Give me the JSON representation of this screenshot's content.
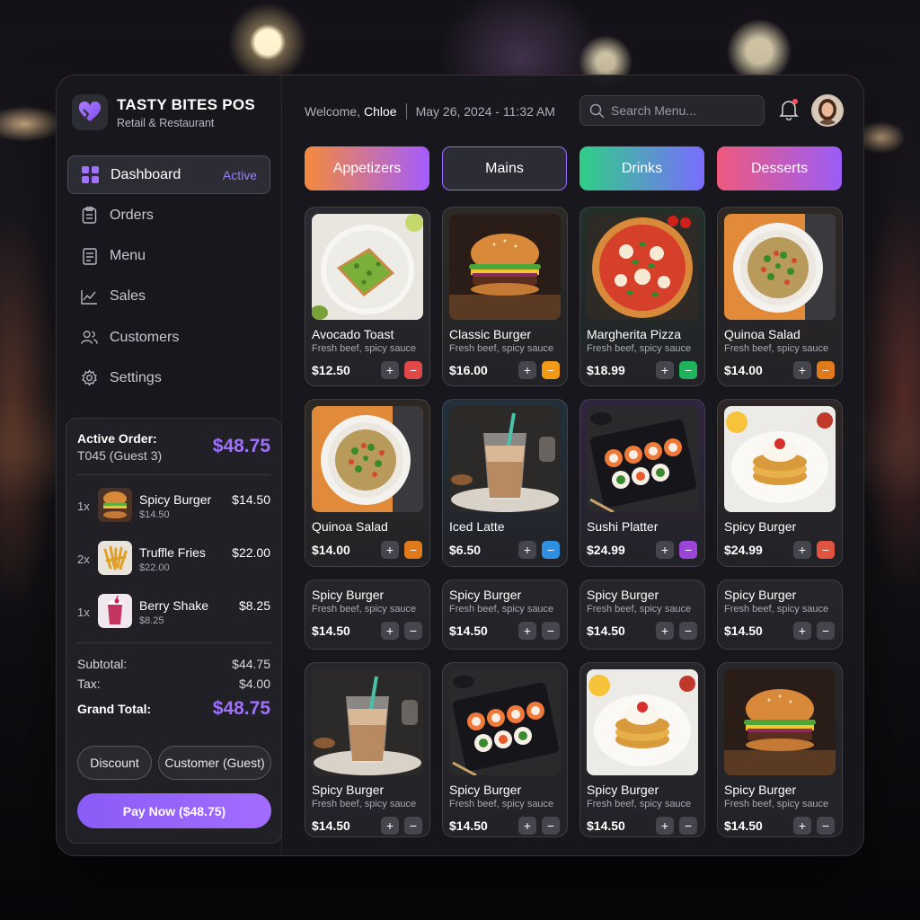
{
  "app": {
    "name": "TASTY BITES POS",
    "subtitle": "Retail & Restaurant",
    "accent": "#9c6bff"
  },
  "nav": {
    "items": [
      {
        "label": "Dashboard",
        "icon": "dashboard-grid-icon",
        "badge": "Active"
      },
      {
        "label": "Orders",
        "icon": "clipboard-icon"
      },
      {
        "label": "Menu",
        "icon": "menu-list-icon"
      },
      {
        "label": "Sales",
        "icon": "chart-line-icon"
      },
      {
        "label": "Customers",
        "icon": "users-icon"
      },
      {
        "label": "Settings",
        "icon": "gear-icon"
      }
    ]
  },
  "header": {
    "welcome_prefix": "Welcome,",
    "user": "Chloe",
    "datetime": "May 26, 2024 - 11:32 AM",
    "search_placeholder": "Search Menu...",
    "has_notification": true
  },
  "categories": [
    {
      "label": "Appetizers",
      "style": "gradient",
      "colors": [
        "#f58a3c",
        "#a35cff"
      ]
    },
    {
      "label": "Mains",
      "style": "selected",
      "colors": [
        "#2c2c34",
        "#9a6bff"
      ]
    },
    {
      "label": "Drinks",
      "style": "gradient",
      "colors": [
        "#2fcf86",
        "#7a6cff"
      ]
    },
    {
      "label": "Desserts",
      "style": "gradient",
      "colors": [
        "#ee5a7e",
        "#9b5cf6"
      ]
    }
  ],
  "menu_items": [
    {
      "name": "Avocado Toast",
      "desc": "Fresh beef, spicy sauce",
      "price": "$12.50",
      "image": "avocado-toast",
      "minus_color": "#e04848",
      "tint": "#2a2a30"
    },
    {
      "name": "Classic Burger",
      "desc": "Fresh beef, spicy sauce",
      "price": "$16.00",
      "image": "burger",
      "minus_color": "#f29a13",
      "tint": "#2c2a26"
    },
    {
      "name": "Margherita Pizza",
      "desc": "Fresh beef, spicy sauce",
      "price": "$18.99",
      "image": "pizza",
      "minus_color": "#1fb35c",
      "tint": "#22302a"
    },
    {
      "name": "Quinoa Salad",
      "desc": "Fresh beef, spicy sauce",
      "price": "$14.00",
      "image": "quinoa-salad",
      "minus_color": "#e07a1a",
      "tint": "#2e2824"
    },
    {
      "name": "Quinoa Salad",
      "desc": "",
      "price": "$14.00",
      "image": "quinoa-salad",
      "minus_color": "#e07a1a",
      "tint": "#2e2824"
    },
    {
      "name": "Iced Latte",
      "desc": "",
      "price": "$6.50",
      "image": "iced-latte",
      "minus_color": "#2f8fe0",
      "tint": "#22303c"
    },
    {
      "name": "Sushi Platter",
      "desc": "",
      "price": "$24.99",
      "image": "sushi",
      "minus_color": "#9a45d8",
      "tint": "#302540"
    },
    {
      "name": "Spicy Burger",
      "desc": "",
      "price": "$24.99",
      "image": "pancake",
      "minus_color": "#e0533f",
      "tint": "#2e2626"
    },
    {
      "name": "Spicy Burger",
      "desc": "Fresh beef, spicy sauce",
      "price": "$14.50",
      "image": "",
      "minus_color": "#45454d",
      "tint": "#26262b"
    },
    {
      "name": "Spicy Burger",
      "desc": "Fresh beef, spicy sauce",
      "price": "$14.50",
      "image": "",
      "minus_color": "#45454d",
      "tint": "#26262b"
    },
    {
      "name": "Spicy Burger",
      "desc": "Fresh beef, spicy sauce",
      "price": "$14.50",
      "image": "",
      "minus_color": "#45454d",
      "tint": "#26262b"
    },
    {
      "name": "Spicy Burger",
      "desc": "Fresh beef, spicy sauce",
      "price": "$14.50",
      "image": "",
      "minus_color": "#45454d",
      "tint": "#26262b"
    },
    {
      "name": "Spicy Burger",
      "desc": "Fresh beef, spicy sauce",
      "price": "$14.50",
      "image": "iced-latte",
      "minus_color": "#45454d",
      "tint": "#26262b"
    },
    {
      "name": "Spicy Burger",
      "desc": "Fresh beef, spicy sauce",
      "price": "$14.50",
      "image": "sushi",
      "minus_color": "#45454d",
      "tint": "#26262b"
    },
    {
      "name": "Spicy Burger",
      "desc": "Fresh beef, spicy sauce",
      "price": "$14.50",
      "image": "pancake",
      "minus_color": "#45454d",
      "tint": "#26262b"
    },
    {
      "name": "Spicy Burger",
      "desc": "Fresh beef, spicy sauce",
      "price": "$14.50",
      "image": "burger",
      "minus_color": "#45454d",
      "tint": "#26262b"
    }
  ],
  "order": {
    "title": "Active Order:",
    "table": "T045 (Guest 3)",
    "total": "$48.75",
    "lines": [
      {
        "qty": "1x",
        "name": "Spicy Burger",
        "unit": "$14.50",
        "price": "$14.50",
        "image": "burger"
      },
      {
        "qty": "2x",
        "name": "Truffle Fries",
        "unit": "$22.00",
        "price": "$22.00",
        "image": "fries"
      },
      {
        "qty": "1x",
        "name": "Berry Shake",
        "unit": "$8.25",
        "price": "$8.25",
        "image": "shake"
      }
    ],
    "subtotal_label": "Subtotal:",
    "subtotal": "$44.75",
    "tax_label": "Tax:",
    "tax": "$4.00",
    "grand_label": "Grand Total:",
    "grand": "$48.75",
    "discount_label": "Discount",
    "customer_label": "Customer (Guest)",
    "pay_label": "Pay Now ($48.75)"
  }
}
